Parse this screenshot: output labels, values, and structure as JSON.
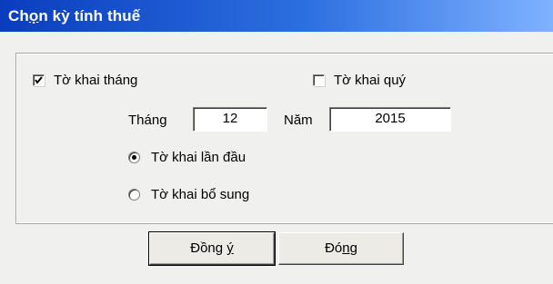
{
  "window": {
    "title_pre": "Ch",
    "title_ul": "ọ",
    "title_post": "n kỳ tính thuế"
  },
  "form": {
    "monthly_checkbox": {
      "label": "Tờ khai tháng",
      "checked": true
    },
    "quarterly_checkbox": {
      "label": "Tờ khai quý",
      "checked": false
    },
    "month_label": "Tháng",
    "month_value": "12",
    "year_label": "Năm",
    "year_value": "2015",
    "first_radio": {
      "label": "Tờ khai lần đầu",
      "selected": true
    },
    "supplement_radio": {
      "label": "Tờ khai bổ sung",
      "selected": false
    }
  },
  "buttons": {
    "ok_pre": "Đồng ",
    "ok_ul": "ý",
    "close_pre": "Đó",
    "close_ul": "n",
    "close_post": "g"
  }
}
